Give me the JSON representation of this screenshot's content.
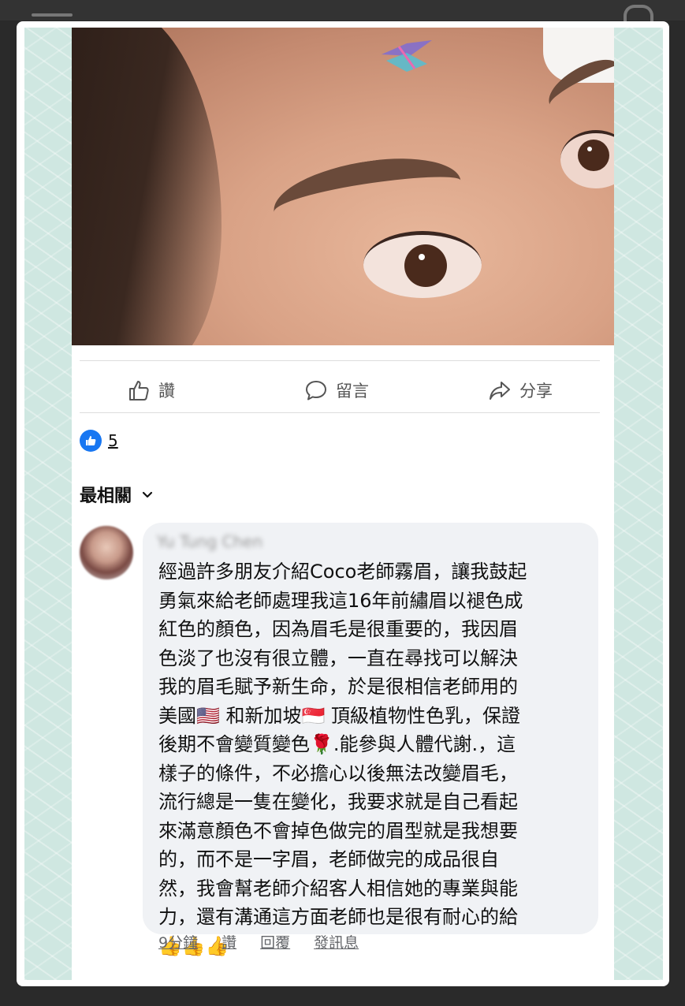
{
  "post": {
    "actions": {
      "like": "讚",
      "comment": "留言",
      "share": "分享"
    },
    "reaction_count": "5"
  },
  "comments_sort": "最相關",
  "comment": {
    "author": "Yu Tung Chen",
    "text": "經過許多朋友介紹Coco老師霧眉，讓我鼓起\n勇氣來給老師處理我這16年前繡眉以褪色成\n紅色的顏色，因為眉毛是很重要的，我因眉\n色淡了也沒有很立體，一直在尋找可以解決\n我的眉毛賦予新生命，於是很相信老師用的\n美國🇺🇸 和新加坡🇸🇬 頂級植物性色乳，保證\n後期不會變質變色🌹.能參與人體代謝.，這\n樣子的條件，不必擔心以後無法改變眉毛，\n流行總是一隻在變化，我要求就是自己看起\n來滿意顏色不會掉色做完的眉型就是我想要\n的，而不是一字眉，老師做完的成品很自\n然，我會幫老師介紹客人相信她的專業與能\n力，還有溝通這方面老師也是很有耐心的給\n👍👍👍",
    "time": "9分鐘",
    "like_label": "讚",
    "reply_label": "回覆",
    "message_label": "發訊息"
  },
  "colors": {
    "accent": "#1877f2",
    "mint_frame": "#cfe7e1"
  }
}
